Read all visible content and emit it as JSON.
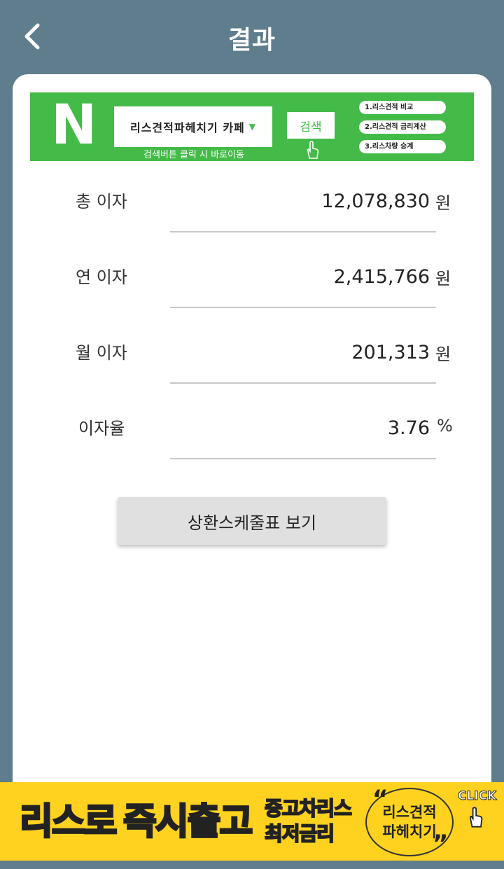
{
  "header": {
    "title": "결과",
    "back_icon": "chevron-left-icon"
  },
  "banner": {
    "logo": "N",
    "cafe_name": "리스견적파헤치기 카페",
    "search_button": "검색",
    "hint": "검색버튼 클릭 시 바로이동",
    "links": [
      "1.리스견적 비교",
      "2.리스견적 금리계산",
      "3.리스차량 승계"
    ],
    "brand_color": "#44bb48"
  },
  "results": [
    {
      "label": "총 이자",
      "value": "12,078,830",
      "unit": "원"
    },
    {
      "label": "연 이자",
      "value": "2,415,766",
      "unit": "원"
    },
    {
      "label": "월 이자",
      "value": "201,313",
      "unit": "원"
    },
    {
      "label": "이자율",
      "value": "3.76",
      "unit": "%"
    }
  ],
  "schedule_button": "상환스케줄표 보기",
  "ad": {
    "text1": "리스로",
    "text2": "즉시출고",
    "text3a": "중고차리스",
    "text3b": "최저금리",
    "circle_line1": "리스견적",
    "circle_line2": "파헤치기",
    "quote_open": "“",
    "quote_close": "”",
    "click": "CLICK",
    "background": "#ffd21f"
  },
  "colors": {
    "app_background": "#5f7d8c",
    "card": "#ffffff"
  }
}
